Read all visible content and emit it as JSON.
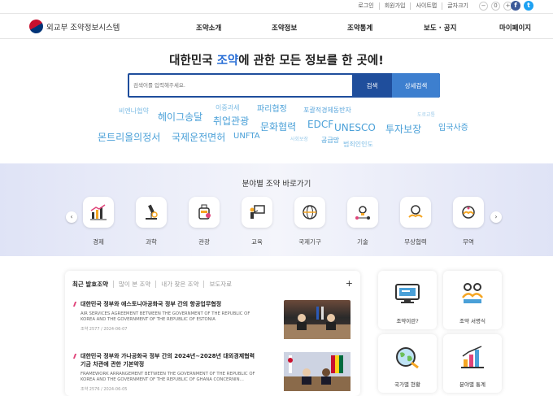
{
  "util": {
    "links": [
      "로그인",
      "회원가입",
      "사이트맵",
      "글자크기"
    ],
    "zoom_minus": "−",
    "zoom_reset": "0",
    "zoom_plus": "+",
    "facebook": "f",
    "twitter": "t"
  },
  "header": {
    "logo_text": "외교부 조약정보시스템",
    "menu": [
      "조약소개",
      "조약정보",
      "조약통계",
      "보도 · 공지",
      "마이페이지"
    ]
  },
  "hero": {
    "title_before": "대한민국 ",
    "title_highlight": "조약",
    "title_after": "에 관한 모든 정보를 한 곳에!",
    "search_placeholder": "검색어를 입력해주세요.",
    "search_button": "검색",
    "detail_button": "상세검색"
  },
  "word_cloud": [
    "비엔나협약",
    "헤이그송달",
    "이중과세",
    "파리협정",
    "포괄적경제동반자",
    "취업관광",
    "문화협력",
    "EDCF",
    "UNESCO",
    "투자보장",
    "입국사증",
    "몬트리올의정서",
    "국제운전면허",
    "UNFTA",
    "공급망",
    "범죄인인도",
    "사회보장",
    "도로교통"
  ],
  "categories": {
    "title": "분야별 조약 바로가기",
    "prev": "‹",
    "next": "›",
    "items": [
      {
        "label": "경제",
        "icon": "economy-chart-icon"
      },
      {
        "label": "과학",
        "icon": "microscope-icon"
      },
      {
        "label": "관광",
        "icon": "luggage-icon"
      },
      {
        "label": "교육",
        "icon": "teacher-board-icon"
      },
      {
        "label": "국제기구",
        "icon": "globe-icon"
      },
      {
        "label": "기술",
        "icon": "technology-icon"
      },
      {
        "label": "무상협력",
        "icon": "handshake-globe-icon"
      },
      {
        "label": "무역",
        "icon": "trade-icon"
      }
    ]
  },
  "news": {
    "tabs": [
      "최근 발효조약",
      "많이 본 조약",
      "내가 찾은 조약",
      "보도자료"
    ],
    "more": "+",
    "items": [
      {
        "title": "대한민국 정부와 에스토니아공화국 정부 간의 항공업무협정",
        "english": "AIR SERVICES AGREEMENT BETWEEN THE GOVERNMENT OF THE REPUBLIC OF KOREA AND THE GOVERNMENT OF THE REPUBLIC OF ESTONIA",
        "meta": "조약 2577 / 2024-06-07"
      },
      {
        "title": "대한민국 정부와 가나공화국 정부 간의 2024년~2028년 대외경제협력기금 차관에 관한 기본약정",
        "english": "FRAMEWORK ARRANGEMENT BETWEEN THE GOVERNMENT OF THE REPUBLIC OF KOREA AND THE GOVERNMENT OF THE REPUBLIC OF GHANA CONCERNIN…",
        "meta": "조약 2576 / 2024-06-05"
      }
    ]
  },
  "quick_links": [
    {
      "label": "조약이란?",
      "icon": "monitor-icon"
    },
    {
      "label": "조약 서명식",
      "icon": "signing-ceremony-icon"
    },
    {
      "label": "국가별 현황",
      "icon": "world-map-icon"
    },
    {
      "label": "분야별 통계",
      "icon": "bar-chart-icon"
    }
  ],
  "colors": {
    "primary": "#1f4e9c",
    "secondary": "#3d7fcf",
    "highlight": "#2a6fd6",
    "cloud": "#4aa0d8",
    "accent": "#e0447a"
  }
}
